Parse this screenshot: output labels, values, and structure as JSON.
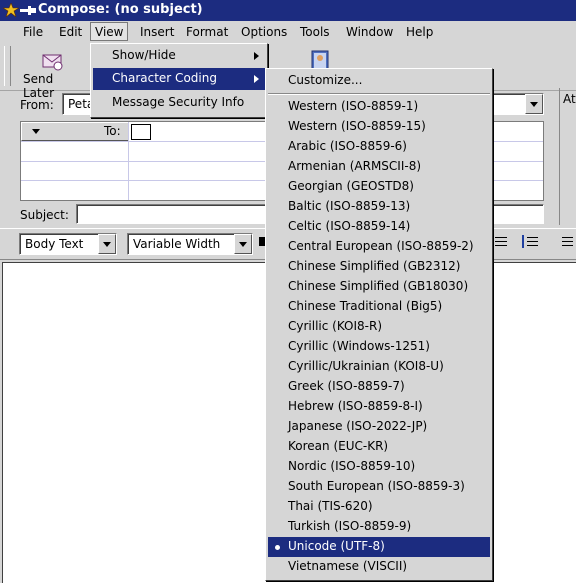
{
  "window": {
    "title": "Compose: (no subject)"
  },
  "menubar": {
    "items": [
      {
        "label": "File"
      },
      {
        "label": "Edit"
      },
      {
        "label": "View"
      },
      {
        "label": "Insert"
      },
      {
        "label": "Format"
      },
      {
        "label": "Options"
      },
      {
        "label": "Tools"
      },
      {
        "label": "Window"
      },
      {
        "label": "Help"
      }
    ]
  },
  "toolbar": {
    "send_later_label": "Send Later"
  },
  "header": {
    "from_label": "From:",
    "from_value": "Peta",
    "to_label": "To:",
    "subject_label": "Subject:",
    "attachments_label": "Att"
  },
  "format_bar": {
    "paragraph_style": "Body Text",
    "font": "Variable Width"
  },
  "view_menu": {
    "items": [
      {
        "label": "Show/Hide"
      },
      {
        "label": "Character Coding"
      },
      {
        "label": "Message Security Info"
      }
    ]
  },
  "charset_menu": {
    "customize": "Customize...",
    "items": [
      {
        "label": "Western (ISO-8859-1)"
      },
      {
        "label": "Western (ISO-8859-15)"
      },
      {
        "label": "Arabic (ISO-8859-6)"
      },
      {
        "label": "Armenian (ARMSCII-8)"
      },
      {
        "label": "Georgian (GEOSTD8)"
      },
      {
        "label": "Baltic (ISO-8859-13)"
      },
      {
        "label": "Celtic (ISO-8859-14)"
      },
      {
        "label": "Central European (ISO-8859-2)"
      },
      {
        "label": "Chinese Simplified (GB2312)"
      },
      {
        "label": "Chinese Simplified (GB18030)"
      },
      {
        "label": "Chinese Traditional (Big5)"
      },
      {
        "label": "Cyrillic (KOI8-R)"
      },
      {
        "label": "Cyrillic (Windows-1251)"
      },
      {
        "label": "Cyrillic/Ukrainian (KOI8-U)"
      },
      {
        "label": "Greek (ISO-8859-7)"
      },
      {
        "label": "Hebrew (ISO-8859-8-I)"
      },
      {
        "label": "Japanese (ISO-2022-JP)"
      },
      {
        "label": "Korean (EUC-KR)"
      },
      {
        "label": "Nordic (ISO-8859-10)"
      },
      {
        "label": "South European (ISO-8859-3)"
      },
      {
        "label": "Thai (TIS-620)"
      },
      {
        "label": "Turkish (ISO-8859-9)"
      },
      {
        "label": "Unicode (UTF-8)"
      },
      {
        "label": "Vietnamese (VISCII)"
      }
    ],
    "selected": "Unicode (UTF-8)"
  },
  "colors": {
    "highlight": "#1c2c80",
    "face": "#d6d6d6"
  }
}
